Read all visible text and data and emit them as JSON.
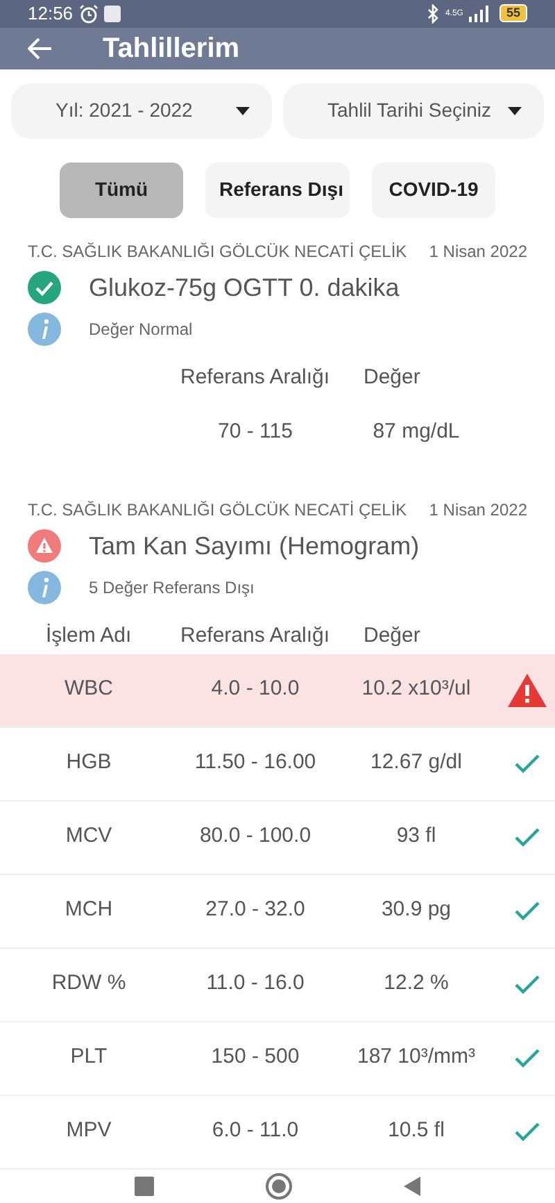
{
  "status_bar": {
    "time": "12:56",
    "network": "4.5G",
    "battery": "55"
  },
  "app_bar": {
    "title": "Tahlillerim"
  },
  "dropdowns": [
    {
      "value": "Yıl: 2021 - 2022"
    },
    {
      "value": "Tahlil Tarihi Seçiniz"
    }
  ],
  "filters": [
    {
      "label": "Tümü",
      "selected": true
    },
    {
      "label": "Referans Dışı",
      "selected": false
    },
    {
      "label": "COVID-19",
      "selected": false
    }
  ],
  "tests": [
    {
      "institution": "T.C. SAĞLIK BAKANLIĞI GÖLCÜK NECATİ ÇELİK",
      "date": "1 Nisan 2022",
      "name": "Glukoz-75g OGTT 0. dakika",
      "out_of_range": false,
      "summary": "Değer Normal",
      "columns": [
        "Referans Aralığı",
        "Değer"
      ],
      "rows": [
        {
          "name": null,
          "range": "70 - 115",
          "value": "87 mg/dL"
        }
      ]
    },
    {
      "institution": "T.C. SAĞLIK BAKANLIĞI GÖLCÜK NECATİ ÇELİK",
      "date": "1 Nisan 2022",
      "name": "Tam Kan Sayımı (Hemogram)",
      "out_of_range": true,
      "summary": "5 Değer Referans Dışı",
      "columns": [
        "İşlem Adı",
        "Referans Aralığı",
        "Değer"
      ],
      "rows": [
        {
          "name": "WBC",
          "range": "4.0 - 10.0",
          "value": "10.2 x10³/ul",
          "out_of_range": true
        },
        {
          "name": "HGB",
          "range": "11.50 - 16.00",
          "value": "12.67 g/dl",
          "out_of_range": false
        },
        {
          "name": "MCV",
          "range": "80.0 - 100.0",
          "value": "93 fl",
          "out_of_range": false
        },
        {
          "name": "MCH",
          "range": "27.0 - 32.0",
          "value": "30.9 pg",
          "out_of_range": false
        },
        {
          "name": "RDW %",
          "range": "11.0 - 16.0",
          "value": "12.2 %",
          "out_of_range": false
        },
        {
          "name": "PLT",
          "range": "150 - 500",
          "value": "187 10³/mm³",
          "out_of_range": false
        },
        {
          "name": "MPV",
          "range": "6.0 - 11.0",
          "value": "10.5 fl",
          "out_of_range": false
        }
      ]
    }
  ]
}
